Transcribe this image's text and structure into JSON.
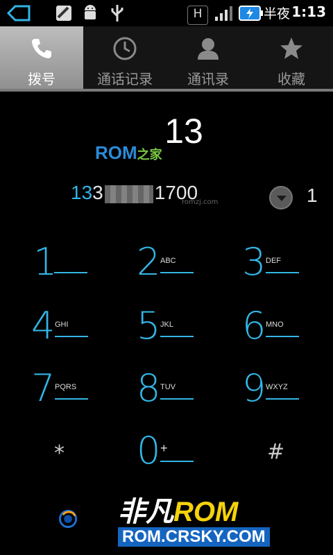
{
  "status_bar": {
    "time": "1:13",
    "ampm": "半夜",
    "network_label": "H"
  },
  "tabs": [
    {
      "label": "拨号",
      "icon": "phone-icon",
      "active": true
    },
    {
      "label": "通话记录",
      "icon": "clock-icon",
      "active": false
    },
    {
      "label": "通讯录",
      "icon": "person-icon",
      "active": false
    },
    {
      "label": "收藏",
      "icon": "star-icon",
      "active": false
    }
  ],
  "display": {
    "digits": "13",
    "watermark_rom": "ROM",
    "watermark_suffix": "之家"
  },
  "suggestion": {
    "number_highlight": "13",
    "number_prefix_rest": "3",
    "number_suffix": "1700",
    "site_small": "romzj.com",
    "count": "1"
  },
  "keypad": [
    {
      "digit": "1",
      "letters": ""
    },
    {
      "digit": "2",
      "letters": "ABC"
    },
    {
      "digit": "3",
      "letters": "DEF"
    },
    {
      "digit": "4",
      "letters": "GHI"
    },
    {
      "digit": "5",
      "letters": "JKL"
    },
    {
      "digit": "6",
      "letters": "MNO"
    },
    {
      "digit": "7",
      "letters": "PQRS"
    },
    {
      "digit": "8",
      "letters": "TUV"
    },
    {
      "digit": "9",
      "letters": "WXYZ"
    },
    {
      "digit": "0",
      "letters": "+"
    }
  ],
  "keypad_symbols": {
    "star": "*",
    "hash": "#"
  },
  "watermark_bottom": {
    "fei": "非凡",
    "rom": "ROM",
    "url": "ROM.CRSKY.COM"
  },
  "colors": {
    "accent": "#33b5e5",
    "tab_active": "#a8a8a8"
  }
}
